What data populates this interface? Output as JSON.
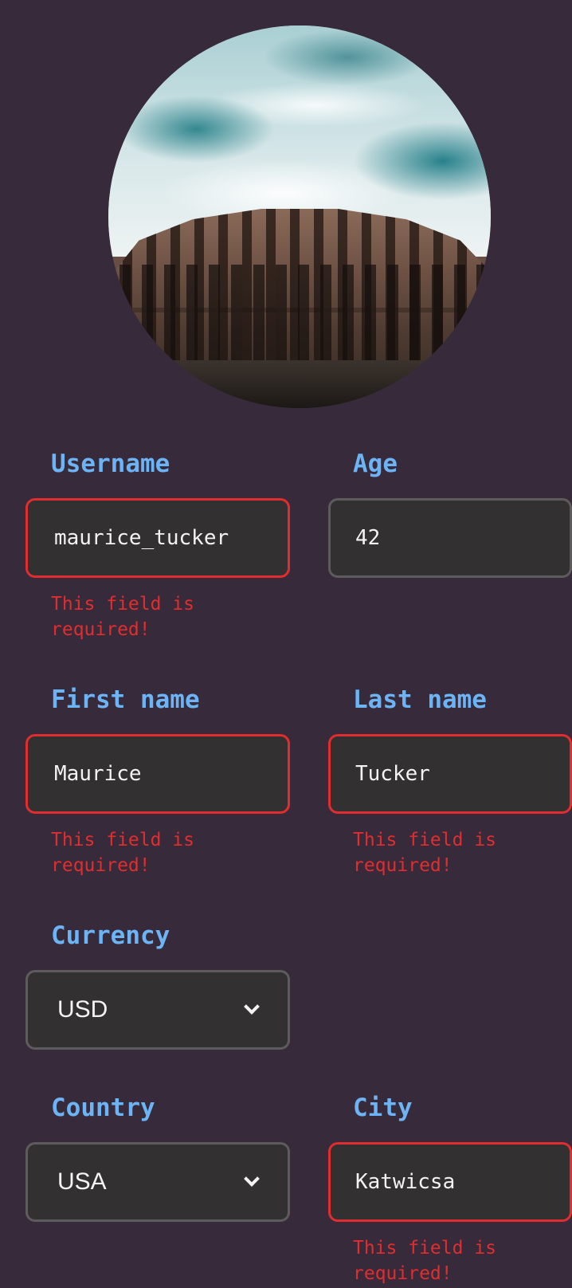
{
  "form": {
    "username": {
      "label": "Username",
      "value": "maurice_tucker",
      "error": "This field is required!"
    },
    "age": {
      "label": "Age",
      "value": "42"
    },
    "first_name": {
      "label": "First name",
      "value": "Maurice",
      "error": "This field is required!"
    },
    "last_name": {
      "label": "Last name",
      "value": "Tucker",
      "error": "This field is required!"
    },
    "currency": {
      "label": "Currency",
      "value": "USD"
    },
    "country": {
      "label": "Country",
      "value": "USA"
    },
    "city": {
      "label": "City",
      "value": "Katwicsa",
      "error": "This field is required!"
    }
  },
  "colors": {
    "background": "#372a3b",
    "label": "#6cb4f5",
    "error": "#e22d2f",
    "field_background": "#323031",
    "field_border": "#5e5b5c"
  },
  "icons": {
    "select_caret": "chevron-down-icon"
  }
}
